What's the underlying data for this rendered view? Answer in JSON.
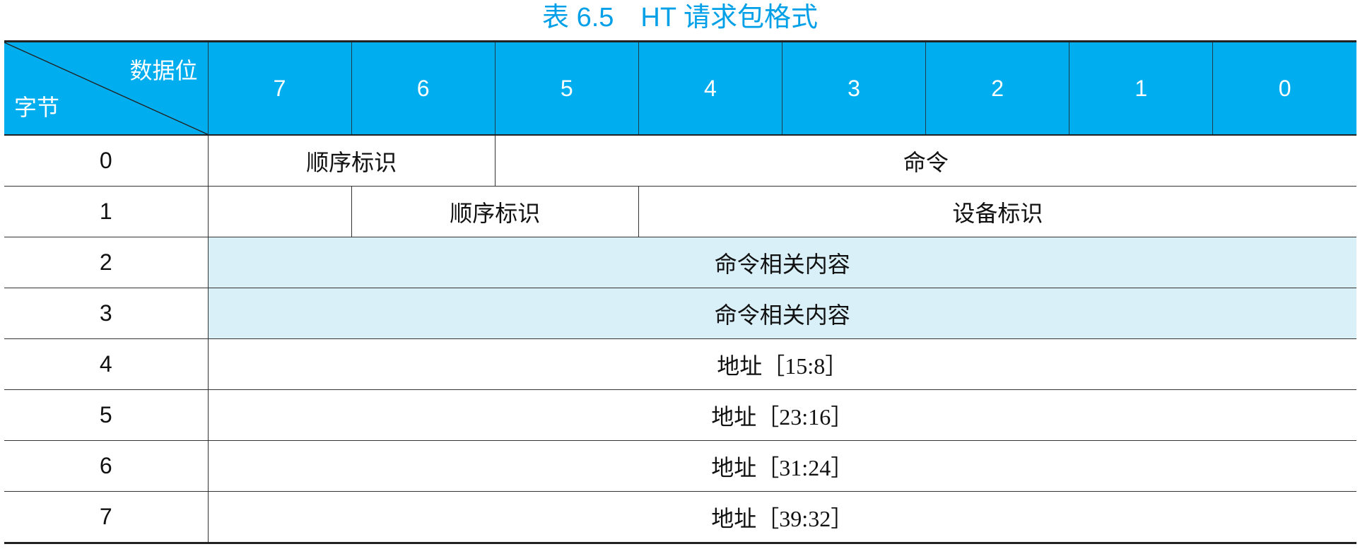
{
  "title": "表 6.5　HT 请求包格式",
  "header": {
    "corner_top": "数据位",
    "corner_bottom": "字节",
    "bits": [
      "7",
      "6",
      "5",
      "4",
      "3",
      "2",
      "1",
      "0"
    ]
  },
  "rows": [
    {
      "byte": "0",
      "fields": [
        "顺序标识",
        "命令"
      ]
    },
    {
      "byte": "1",
      "fields": [
        "顺序标识",
        "设备标识"
      ]
    },
    {
      "byte": "2",
      "fields": [
        "命令相关内容"
      ]
    },
    {
      "byte": "3",
      "fields": [
        "命令相关内容"
      ]
    },
    {
      "byte": "4",
      "fields": [
        "地址［15:8］"
      ]
    },
    {
      "byte": "5",
      "fields": [
        "地址［23:16］"
      ]
    },
    {
      "byte": "6",
      "fields": [
        "地址［31:24］"
      ]
    },
    {
      "byte": "7",
      "fields": [
        "地址［39:32］"
      ]
    }
  ],
  "colors": {
    "title": "#00a0e9",
    "header_background": "#00aeef",
    "header_text": "#ffffff",
    "highlight_background": "#daf0f9"
  }
}
